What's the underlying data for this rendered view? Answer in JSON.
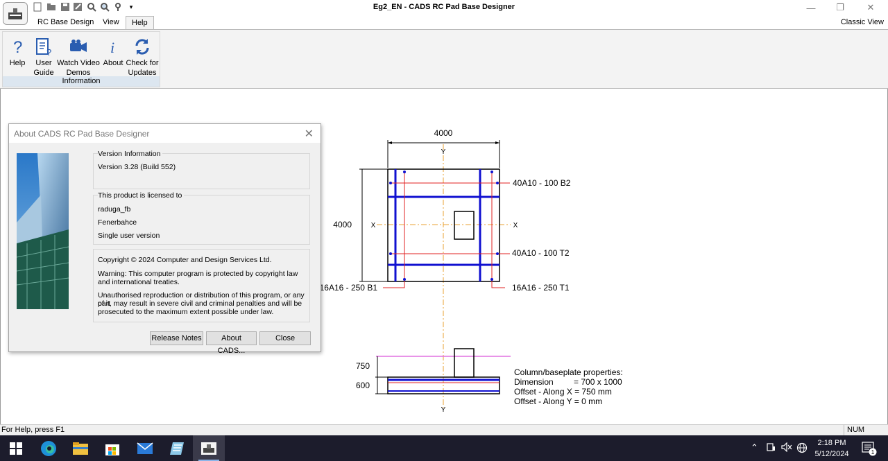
{
  "window": {
    "title": "Eg2_EN - CADS RC Pad Base Designer"
  },
  "tabs": [
    {
      "label": "RC Base Design"
    },
    {
      "label": "View"
    },
    {
      "label": "Help"
    }
  ],
  "classic_view": "Classic View",
  "ribbon": {
    "group_label": "Information",
    "buttons": [
      {
        "line1": "Help",
        "line2": "",
        "icon": "help-question-icon"
      },
      {
        "line1": "User",
        "line2": "Guide",
        "icon": "user-guide-icon"
      },
      {
        "line1": "Watch Video",
        "line2": "Demos",
        "icon": "video-camera-icon"
      },
      {
        "line1": "About",
        "line2": "",
        "icon": "info-icon"
      },
      {
        "line1": "Check for",
        "line2": "Updates",
        "icon": "refresh-icon"
      }
    ]
  },
  "drawing": {
    "plan_width": "4000",
    "plan_height": "4000",
    "axis_y": "Y",
    "axis_x": "X",
    "bar_b2": "40A10 - 100 B2",
    "bar_t2": "40A10 - 100 T2",
    "bar_b1": "16A16 - 250 B1",
    "bar_t1": "16A16 - 250 T1",
    "elev_col": "750",
    "elev_base": "600",
    "props_title": "Column/baseplate properties:",
    "props": [
      {
        "label": "Dimension",
        "value": "= 700 x 1000"
      },
      {
        "label": "Offset - Along X = 750 mm",
        "value": ""
      },
      {
        "label": "Offset - Along Y = 0 mm",
        "value": ""
      }
    ]
  },
  "dialog": {
    "title": "About CADS RC Pad Base Designer",
    "version_heading": "Version Information",
    "version": "Version 3.28 (Build 552)",
    "license_heading": "This product is licensed to",
    "user": "raduga_fb",
    "company": "Fenerbahce",
    "license_type": "Single user version",
    "copyright": "Copyright © 2024 Computer and Design Services Ltd.",
    "warning1": "Warning: This computer program is protected by copyright law",
    "warning2": "and international treaties.",
    "unauth1": "Unauthorised reproduction or distribution of this program, or any part",
    "unauth2": "of it, may result in severe civil and criminal penalties and will be",
    "unauth3": "prosecuted to the maximum extent possible under law.",
    "btn_release": "Release Notes",
    "btn_about": "About CADS...",
    "btn_close": "Close"
  },
  "status": {
    "help": "For Help, press F1",
    "num": "NUM"
  },
  "taskbar": {
    "time": "2:18 PM",
    "date": "5/12/2024",
    "notifications": "1"
  },
  "colors": {
    "rebar_blue": "#1010d0",
    "rebar_red": "#e02020",
    "axis_orange": "#e8a030",
    "ribbon_label_bg": "#dce6f0"
  }
}
